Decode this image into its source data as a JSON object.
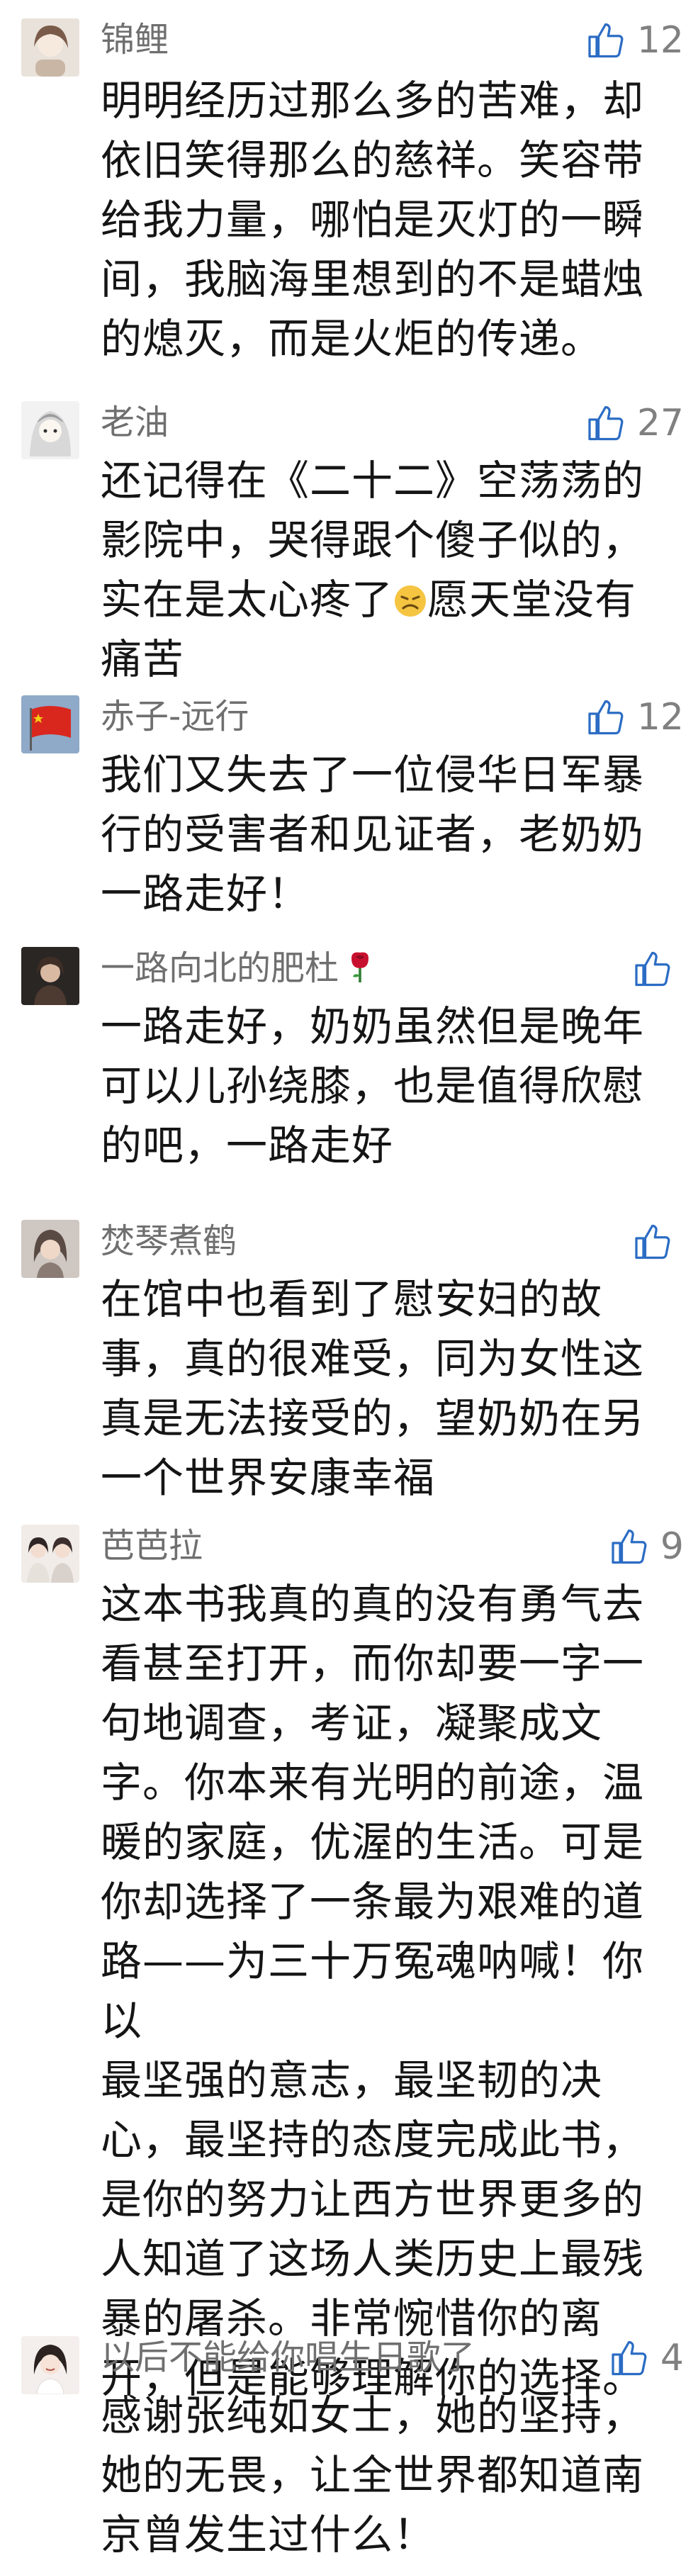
{
  "comments": [
    {
      "username": "锦鲤",
      "likes": "12",
      "text": "明明经历过那么多的苦难，却\n依旧笑得那么的慈祥。笑容带\n给我力量，哪怕是灭灯的一瞬\n间，我脑海里想到的不是蜡烛\n的熄灭，而是火炬的传递。",
      "avatar_icon": "illustrated-girl-avatar"
    },
    {
      "username": "老油",
      "likes": "27",
      "text_before_emoji": "还记得在《二十二》空荡荡的\n影院中，哭得跟个傻子似的，\n实在是太心疼了",
      "emoji_icon": "sad-face-emoji",
      "text_after_emoji": "愿天堂没有\n痛苦",
      "avatar_icon": "anime-character-avatar"
    },
    {
      "username": "赤子-远行",
      "likes": "12",
      "text": "我们又失去了一位侵华日军暴\n行的受害者和见证者，老奶奶\n一路走好！",
      "avatar_icon": "red-flag-avatar"
    },
    {
      "username": "一路向北的肥杜",
      "username_emoji": "rose-emoji",
      "likes": "",
      "text": "一路走好，奶奶虽然但是晚年\n可以儿孙绕膝，也是值得欣慰\n的吧，一路走好",
      "avatar_icon": "dark-portrait-avatar"
    },
    {
      "username": "焚琴煮鹤",
      "likes": "",
      "text": "在馆中也看到了慰安妇的故\n事，真的很难受，同为女性这\n真是无法接受的，望奶奶在另\n一个世界安康幸福",
      "avatar_icon": "woman-portrait-avatar"
    },
    {
      "username": "芭芭拉",
      "likes": "9",
      "text": "这本书我真的真的没有勇气去\n看甚至打开，而你却要一字一\n句地调查，考证，凝聚成文\n字。你本来有光明的前途，温\n暖的家庭，优渥的生活。可是\n你却选择了一条最为艰难的道\n路——为三十万冤魂呐喊！你以\n最坚强的意志，最坚韧的决\n心，最坚持的态度完成此书，\n是你的努力让西方世界更多的\n人知道了这场人类历史上最残\n暴的屠杀。非常惋惜你的离\n开，但是能够理解你的选择。",
      "avatar_icon": "two-girls-avatar"
    },
    {
      "username": "以后不能给你唱生日歌了",
      "likes": "4",
      "text": "感谢张纯如女士，她的坚持，\n她的无畏，让全世界都知道南\n京曾发生过什么！",
      "avatar_icon": "woman-smiling-avatar"
    }
  ],
  "colors": {
    "username": "#6f6f6f",
    "body_text": "#151515",
    "like_icon": "#2b6cc4",
    "like_count": "#808080"
  }
}
